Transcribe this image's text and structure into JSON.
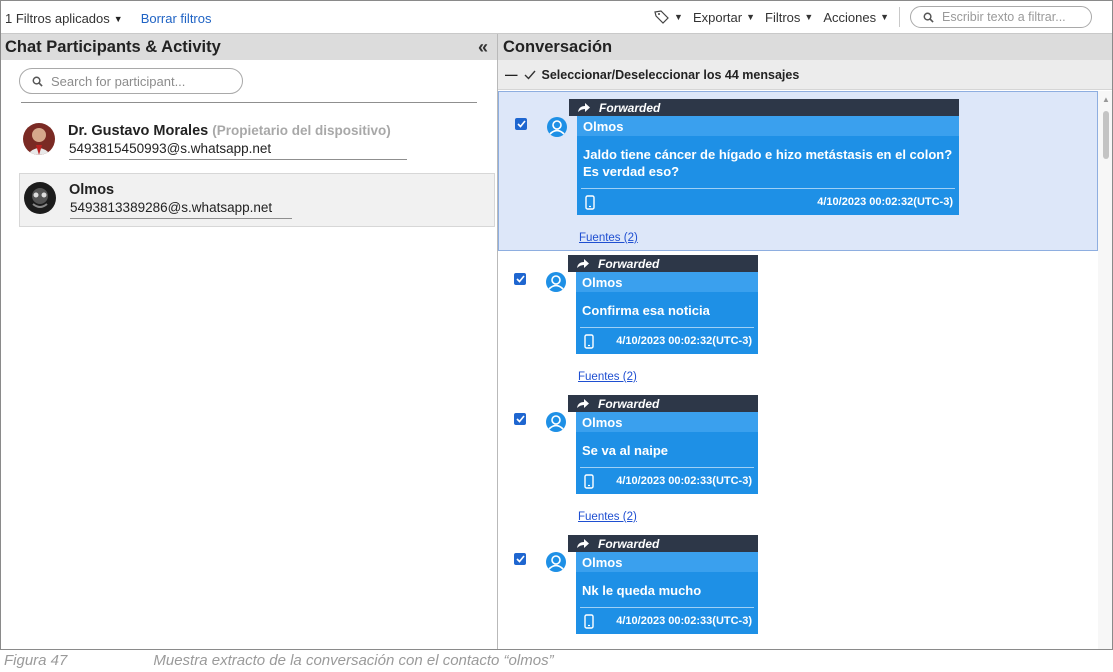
{
  "toolbar": {
    "filters_applied": "1 Filtros aplicados",
    "clear_filters": "Borrar filtros",
    "export_label": "Exportar",
    "filters_label": "Filtros",
    "actions_label": "Acciones",
    "search_placeholder": "Escribir texto a filtrar..."
  },
  "left_pane": {
    "title": "Chat Participants & Activity",
    "search_placeholder": "Search for participant...",
    "participants": [
      {
        "name": "Dr. Gustavo Morales",
        "role": "(Propietario del dispositivo)",
        "id": "5493815450993@s.whatsapp.net"
      },
      {
        "name": "Olmos",
        "role": "",
        "id": "5493813389286@s.whatsapp.net"
      }
    ]
  },
  "right_pane": {
    "title": "Conversación",
    "select_all_label": "Seleccionar/Deseleccionar los 44 mensajes",
    "messages": [
      {
        "forwarded_label": "Forwarded",
        "sender": "Olmos",
        "text": "Jaldo tiene cáncer de hígado e hizo metástasis en el colon? Es verdad eso?",
        "timestamp": "4/10/2023 00:02:32(UTC-3)",
        "sources": "Fuentes (2)",
        "checked": true
      },
      {
        "forwarded_label": "Forwarded",
        "sender": "Olmos",
        "text": "Confirma esa noticia",
        "timestamp": "4/10/2023 00:02:32(UTC-3)",
        "sources": "Fuentes (2)",
        "checked": true
      },
      {
        "forwarded_label": "Forwarded",
        "sender": "Olmos",
        "text": "Se va al naipe",
        "timestamp": "4/10/2023 00:02:33(UTC-3)",
        "sources": "Fuentes (2)",
        "checked": true
      },
      {
        "forwarded_label": "Forwarded",
        "sender": "Olmos",
        "text": "Nk le queda mucho",
        "timestamp": "4/10/2023 00:02:33(UTC-3)",
        "sources": "",
        "checked": true
      }
    ]
  },
  "caption": {
    "figure": "Figura 47",
    "description": "Muestra extracto de la conversación con el contacto “olmos”"
  },
  "colors": {
    "bubble": "#1e90e6",
    "bubble_header": "#3aa0ee",
    "forwarded_bar": "#2d3748",
    "selected_row": "#dde7f9",
    "link": "#1f63c4"
  },
  "icons": [
    "tag-icon",
    "search-icon",
    "collapse-icon",
    "forward-arrow-icon",
    "user-icon",
    "phone-icon",
    "checkbox-icon"
  ]
}
